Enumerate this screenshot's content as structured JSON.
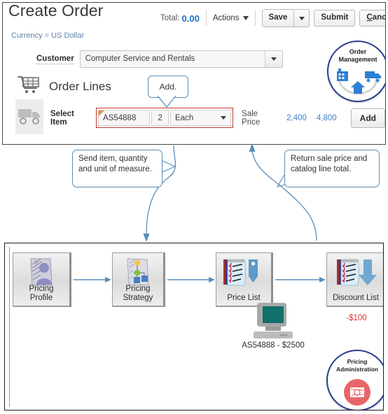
{
  "header": {
    "title": "Create Order",
    "total_label": "Total:",
    "total_value": "0.00",
    "actions_label": "Actions",
    "save_label": "Save",
    "submit_label": "Submit",
    "cancel_accesskey": "C",
    "cancel_rest": "ancel"
  },
  "currency_note": "Currency = US Dollar",
  "customer": {
    "label": "Customer",
    "value": "Computer Service and Rentals"
  },
  "order_lines": {
    "title": "Order Lines",
    "select_item_label": "Select Item",
    "item_code": "AS54888",
    "quantity": "2",
    "uom": "Each",
    "sale_price_label": "Sale Price",
    "sale_price": "2,400",
    "line_total": "4,800",
    "add_button_label": "Add",
    "add_callout": "Add."
  },
  "badges": {
    "order_management_line1": "Order",
    "order_management_line2": "Management",
    "pricing_administration_line1": "Pricing",
    "pricing_administration_line2": "Administration"
  },
  "callouts": {
    "send": "Send item, quantity and unit of measure.",
    "return": "Return sale price and catalog line total."
  },
  "flow": {
    "nodes": [
      {
        "id": "pricing-profile",
        "line1": "Pricing",
        "line2": "Profile"
      },
      {
        "id": "pricing-strategy",
        "line1": "Pricing",
        "line2": "Strategy"
      },
      {
        "id": "price-list",
        "line1": "Price List",
        "line2": ""
      },
      {
        "id": "discount-list",
        "line1": "Discount List",
        "line2": ""
      }
    ],
    "monitor_label": "AS54888 - $2500",
    "discount_amount": "-$100"
  },
  "colors": {
    "accent_blue": "#3f7fc4",
    "link_blue": "#1a73c8",
    "callout_border": "#5b8db8",
    "highlight_red": "#c0392b",
    "discount_red": "#e03030",
    "badge_navy": "#2b3f91",
    "pricing_admin_circle": "#e8656a"
  }
}
